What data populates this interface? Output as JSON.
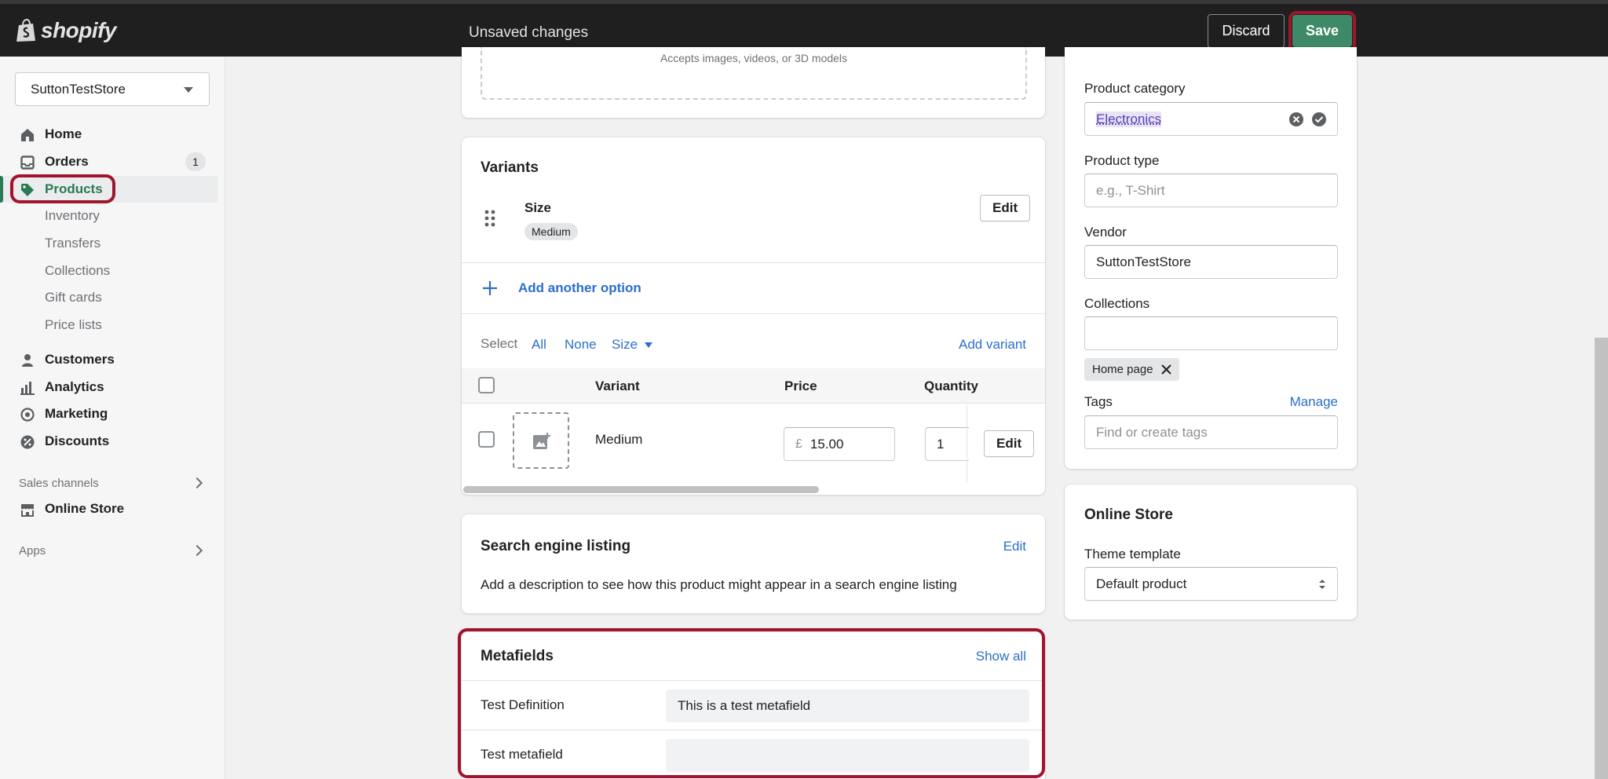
{
  "topbar": {
    "logo_text": "shopify",
    "status": "Unsaved changes",
    "discard_label": "Discard",
    "save_label": "Save"
  },
  "sidebar": {
    "store_name": "SuttonTestStore",
    "nav": {
      "home": "Home",
      "orders": "Orders",
      "orders_count": "1",
      "products": "Products",
      "inventory": "Inventory",
      "transfers": "Transfers",
      "collections": "Collections",
      "gift_cards": "Gift cards",
      "price_lists": "Price lists",
      "customers": "Customers",
      "analytics": "Analytics",
      "marketing": "Marketing",
      "discounts": "Discounts"
    },
    "sales_channels_label": "Sales channels",
    "online_store": "Online Store",
    "apps_label": "Apps"
  },
  "media": {
    "accepts_text": "Accepts images, videos, or 3D models"
  },
  "variants": {
    "title": "Variants",
    "option_name": "Size",
    "option_value": "Medium",
    "edit_label": "Edit",
    "add_option_label": "Add another option",
    "select_label": "Select",
    "select_all": "All",
    "select_none": "None",
    "select_size": "Size",
    "add_variant_label": "Add variant",
    "columns": {
      "variant": "Variant",
      "price": "Price",
      "quantity": "Quantity"
    },
    "rows": [
      {
        "name": "Medium",
        "currency": "£",
        "price": "15.00",
        "quantity": "1",
        "edit": "Edit"
      }
    ]
  },
  "seo": {
    "title": "Search engine listing",
    "edit_label": "Edit",
    "description": "Add a description to see how this product might appear in a search engine listing"
  },
  "metafields": {
    "title": "Metafields",
    "show_all_label": "Show all",
    "rows": [
      {
        "label": "Test Definition",
        "value": "This is a test metafield"
      },
      {
        "label": "Test metafield",
        "value": ""
      }
    ]
  },
  "organization": {
    "category_label": "Product category",
    "category_value": "Electronics",
    "type_label": "Product type",
    "type_placeholder": "e.g., T-Shirt",
    "vendor_label": "Vendor",
    "vendor_value": "SuttonTestStore",
    "collections_label": "Collections",
    "collection_tag": "Home page",
    "tags_label": "Tags",
    "manage_label": "Manage",
    "tags_placeholder": "Find or create tags"
  },
  "online_store_card": {
    "title": "Online Store",
    "theme_label": "Theme template",
    "theme_value": "Default product"
  },
  "colors": {
    "accent_green": "#3e8a68",
    "highlight_red": "#a0152d",
    "link_blue": "#2c6ecb"
  }
}
